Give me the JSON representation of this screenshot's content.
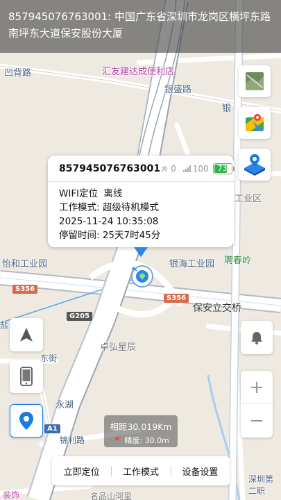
{
  "address_banner": "857945076763001: 中国广东省深圳市龙岗区横坪东路南坪东大道保安股份大厦",
  "map_labels": {
    "aobei_road": "凹背路",
    "shop": "汇友建达成便利店",
    "yinsheng_road": "银盛路",
    "yin_partial": "银",
    "industrial_zone": "工业区",
    "yihe": "怡和工业园",
    "yinhai": "银海工业园",
    "pingchun": "聘春岭",
    "s356_left": "S356",
    "s356_right": "S356",
    "g205": "G205",
    "a1": "A1",
    "baoan_interchange": "保安立交桥",
    "zhuohong": "卓弘星辰",
    "yongrong": "永湖",
    "jinli": "锦利路",
    "mingpin": "名品山河里",
    "shenzhen2": "深圳第二职",
    "dongjie": "东街",
    "zhuangshi": "装饰",
    "yan": "盐"
  },
  "popup": {
    "device_id": "857945076763001",
    "satellite_count": "0",
    "signal_value": "100",
    "battery_value": "73",
    "battery_level": 73,
    "location_mode": "WIFI定位",
    "status": "离线",
    "work_mode": "工作模式: 超级待机模式",
    "datetime": "2025-11-24 10:35:08",
    "stay_time": "停留时间: 25天7时45分"
  },
  "distance_box": {
    "distance": "相距30.019Km",
    "accuracy": "精度: 30.0m"
  },
  "controls": {
    "zoom_in": "+",
    "zoom_out": "−"
  },
  "bottom_bar": {
    "locate_now": "立即定位",
    "work_mode": "工作模式",
    "device_settings": "设备设置"
  },
  "colors": {
    "accent_blue": "#1a7ce6",
    "battery_green": "#34b24a"
  }
}
